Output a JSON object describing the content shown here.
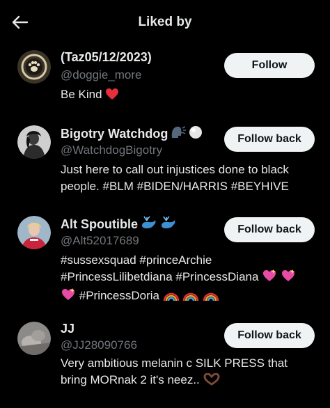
{
  "header": {
    "back_icon": "arrow-left-icon",
    "title": "Liked by"
  },
  "users": [
    {
      "name": "(Taz05/12/2023)",
      "handle": "@doggie_more",
      "bio_text": "Be Kind",
      "bio_emoji": "red-heart",
      "button": "Follow"
    },
    {
      "name": "Bigotry Watchdog",
      "name_emojis": [
        "speaking-head",
        "white-circle"
      ],
      "handle": "@WatchdogBigotry",
      "bio_line1": "Just here to call out injustices done to black",
      "bio_line2": "people. #BLM #BIDEN/HARRIS #BEYHIVE",
      "button": "Follow back"
    },
    {
      "name": "Alt Spoutible",
      "name_emojis": [
        "spouting-whale",
        "spouting-whale"
      ],
      "handle": "@Alt52017689",
      "bio_line1": "#sussexsquad #princeArchie",
      "bio_line2": "#PrincessLilibetdiana #PrincessDiana",
      "bio_line3": "#PrincessDoria",
      "button": "Follow back"
    },
    {
      "name": "JJ",
      "handle": "@JJ28090766",
      "bio_line1": "Very ambitious melanin c SILK PRESS that",
      "bio_line2": "bring MORnak 2 it's neez..",
      "button": "Follow back"
    }
  ]
}
